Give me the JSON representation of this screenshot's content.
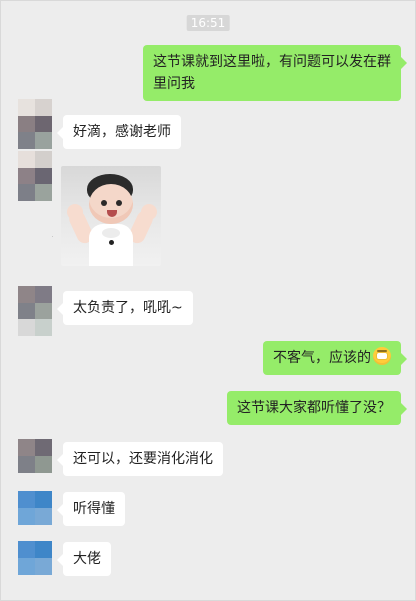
{
  "chat": {
    "timestamp": "16:51",
    "messages": [
      {
        "side": "right",
        "text": "这节课就到这里啦，有问题可以发在群",
        "text2": "里问我"
      },
      {
        "side": "left",
        "text": "好滴，感谢老师"
      },
      {
        "side": "left",
        "type": "image",
        "icon": "baby-photo"
      },
      {
        "side": "left",
        "text": "太负责了，吼吼~"
      },
      {
        "side": "right",
        "text": "不客气，应该的",
        "emoji": "grimacing-emoji"
      },
      {
        "side": "right",
        "text": "这节课大家都听懂了没？"
      },
      {
        "side": "left",
        "text": "还可以，还要消化消化"
      },
      {
        "side": "left",
        "text": "听得懂"
      },
      {
        "side": "left",
        "text": "大佬"
      }
    ]
  },
  "colors": {
    "background": "#ededed",
    "bubble_right": "#95ec69",
    "bubble_left": "#ffffff",
    "timestamp_bg": "#d7d7d7"
  }
}
